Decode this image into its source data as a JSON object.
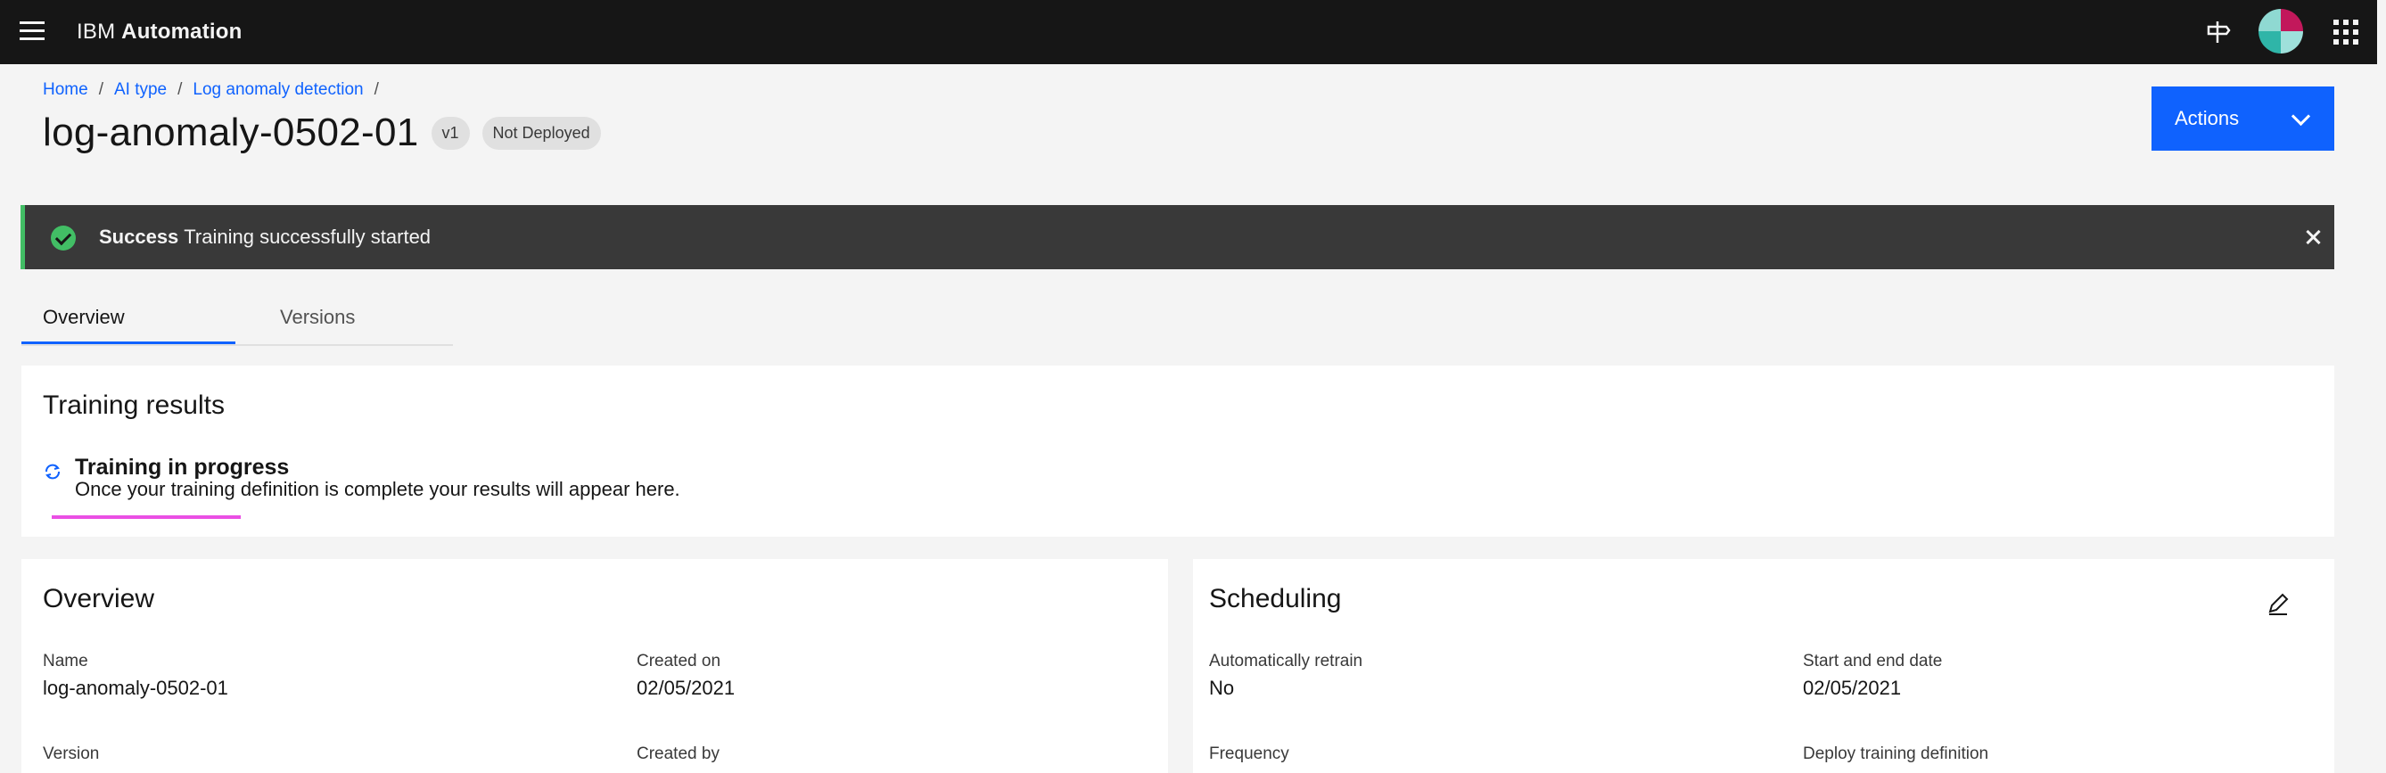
{
  "header": {
    "brand_prefix": "IBM",
    "brand_name": "Automation"
  },
  "breadcrumb": {
    "items": [
      "Home",
      "AI type",
      "Log anomaly detection"
    ],
    "separator": "/"
  },
  "page": {
    "title": "log-anomaly-0502-01",
    "version_tag": "v1",
    "status_tag": "Not Deployed",
    "actions_label": "Actions"
  },
  "notification": {
    "title": "Success",
    "message": "Training successfully started"
  },
  "tabs": [
    {
      "label": "Overview",
      "active": true
    },
    {
      "label": "Versions",
      "active": false
    }
  ],
  "training_results": {
    "title": "Training results",
    "status_title": "Training in progress",
    "status_desc": "Once your training definition is complete your results will appear here."
  },
  "overview": {
    "title": "Overview",
    "fields": [
      {
        "label": "Name",
        "value": "log-anomaly-0502-01"
      },
      {
        "label": "Created on",
        "value": "02/05/2021"
      },
      {
        "label": "Version",
        "value": ""
      },
      {
        "label": "Created by",
        "value": ""
      }
    ]
  },
  "scheduling": {
    "title": "Scheduling",
    "fields": [
      {
        "label": "Automatically retrain",
        "value": "No"
      },
      {
        "label": "Start and end date",
        "value": "02/05/2021"
      },
      {
        "label": "Frequency",
        "value": ""
      },
      {
        "label": "Deploy training definition",
        "value": ""
      }
    ]
  },
  "colors": {
    "primary": "#0f62fe",
    "success": "#42be65",
    "progress": "#ea4fe4",
    "header_bg": "#161616"
  },
  "icons": [
    "menu-icon",
    "pin-icon",
    "avatar",
    "app-switcher-icon",
    "checkmark-icon",
    "close-icon",
    "chevron-down-icon",
    "renew-icon",
    "edit-icon"
  ]
}
